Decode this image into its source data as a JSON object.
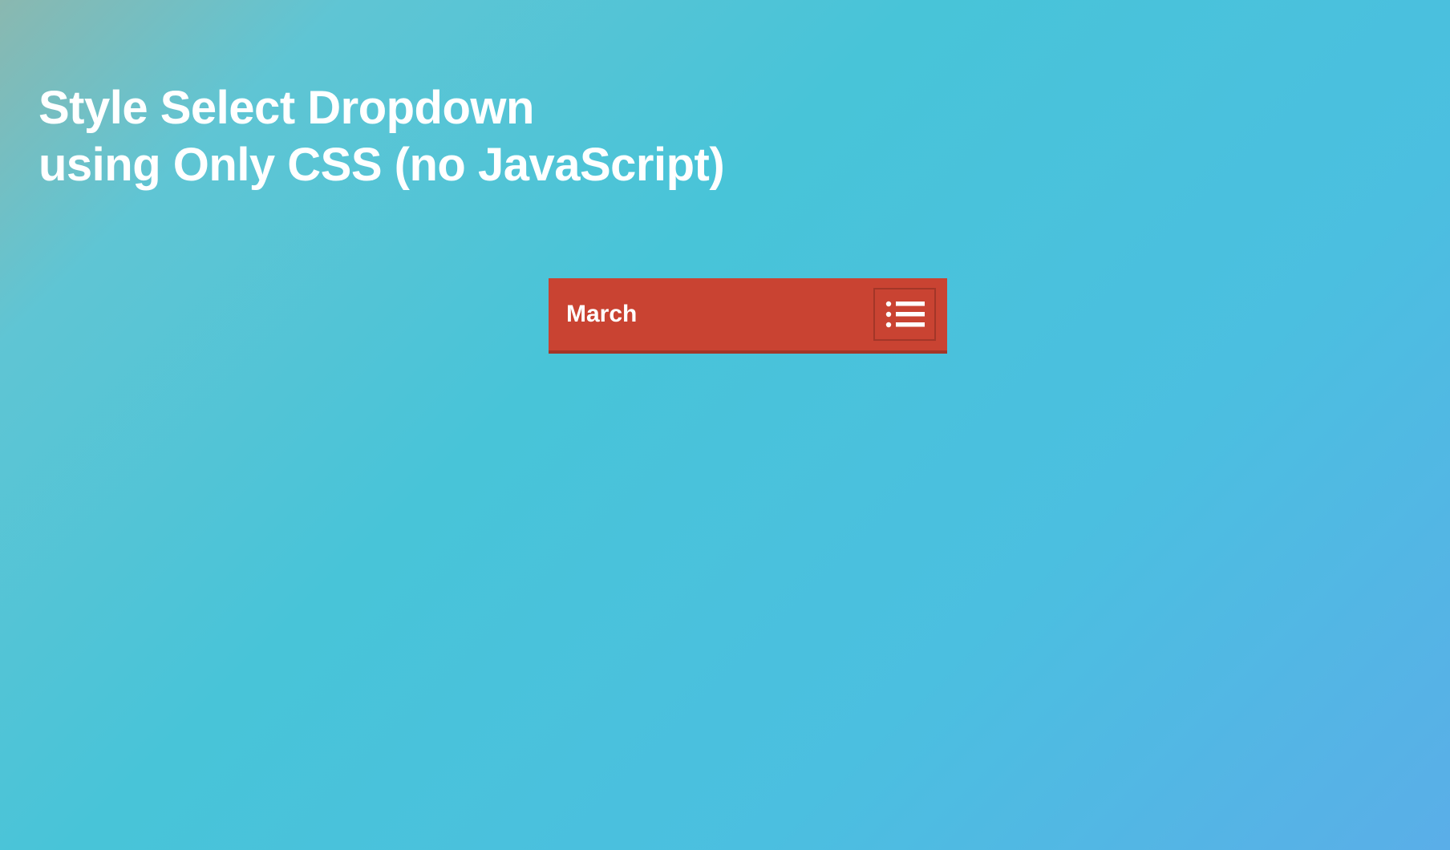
{
  "title": "Style Select Dropdown\nusing Only CSS (no JavaScript)",
  "dropdown": {
    "selected": "March",
    "icon": "list-icon"
  },
  "colors": {
    "dropdown_bg": "#c94332",
    "dropdown_border": "#a33628",
    "text": "#ffffff"
  }
}
